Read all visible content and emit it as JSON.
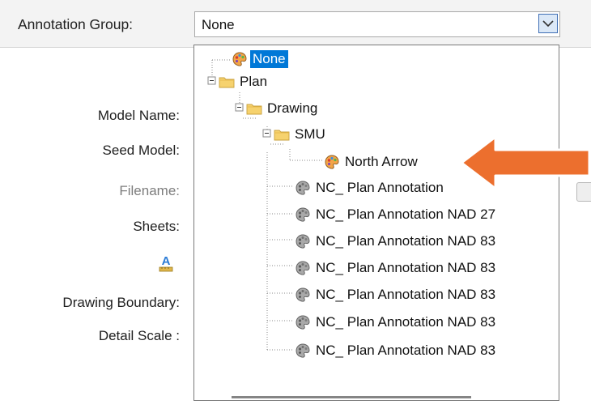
{
  "header": {
    "annotation_group_label": "Annotation Group:",
    "annotation_group_value": "None"
  },
  "form": {
    "model_name_label": "Model Name:",
    "seed_model_label": "Seed Model:",
    "filename_label": "Filename:",
    "sheets_label": "Sheets:",
    "drawing_boundary_label": "Drawing Boundary:",
    "detail_scale_label": "Detail Scale :"
  },
  "tree": {
    "items": [
      {
        "label": "None",
        "icon": "palette-icon",
        "selected": true
      },
      {
        "label": "Plan",
        "icon": "folder-icon",
        "expanded": true
      },
      {
        "label": "Drawing",
        "icon": "folder-icon",
        "expanded": true
      },
      {
        "label": "SMU",
        "icon": "folder-icon",
        "expanded": true
      },
      {
        "label": "North Arrow",
        "icon": "palette-icon"
      },
      {
        "label": "NC_ Plan Annotation",
        "icon": "palette-gray-icon"
      },
      {
        "label": "NC_ Plan Annotation NAD 27",
        "icon": "palette-gray-icon"
      },
      {
        "label": "NC_ Plan Annotation NAD 83",
        "icon": "palette-gray-icon"
      },
      {
        "label": "NC_ Plan Annotation NAD 83",
        "icon": "palette-gray-icon"
      },
      {
        "label": "NC_ Plan Annotation NAD 83",
        "icon": "palette-gray-icon"
      },
      {
        "label": "NC_ Plan Annotation NAD 83",
        "icon": "palette-gray-icon"
      },
      {
        "label": "NC_ Plan Annotation NAD 83",
        "icon": "palette-gray-icon"
      }
    ]
  },
  "colors": {
    "selection": "#0078d7",
    "callout_arrow": "#ec6f2e",
    "folder": "#f6d26e"
  }
}
